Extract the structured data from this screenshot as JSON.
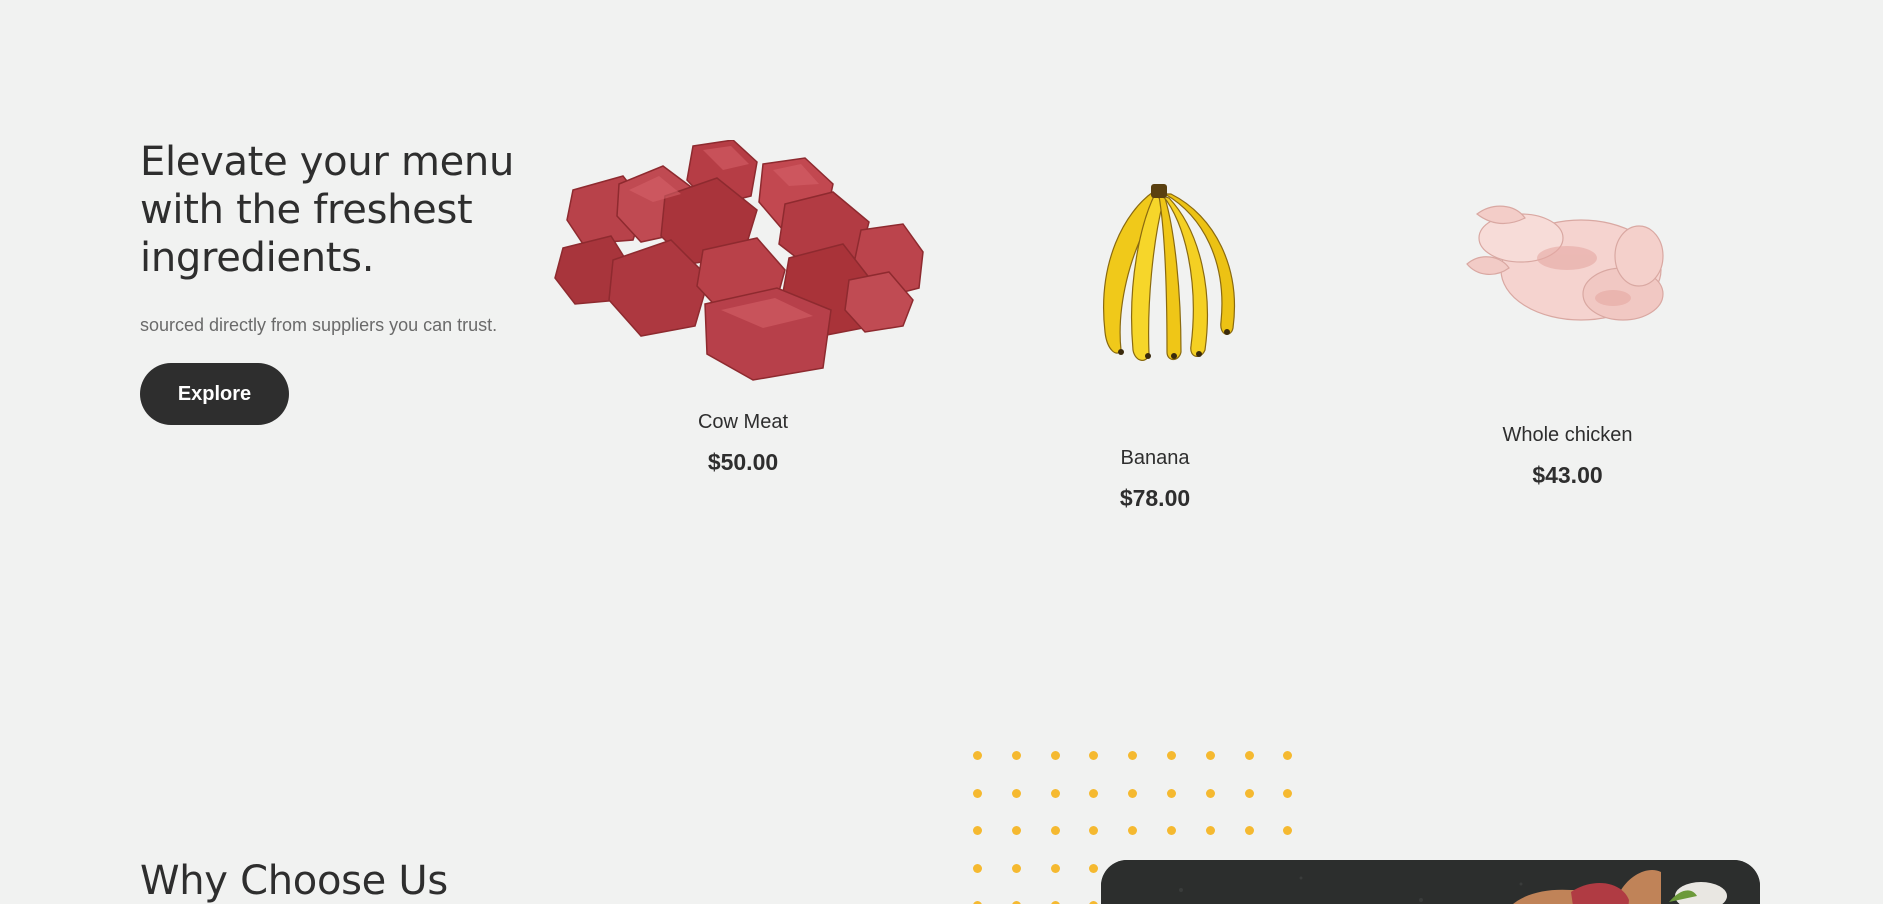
{
  "hero": {
    "title": "Elevate your menu with the freshest ingredients.",
    "subtitle": "sourced directly from suppliers you can trust.",
    "cta_label": "Explore"
  },
  "products": [
    {
      "name": "Cow Meat",
      "price": "$50.00"
    },
    {
      "name": "Banana",
      "price": "$78.00"
    },
    {
      "name": "Whole chicken",
      "price": "$43.00"
    }
  ],
  "why_section": {
    "title": "Why Choose Us"
  },
  "colors": {
    "background": "#f1f2f1",
    "text": "#2e2e2e",
    "button": "#2e2e2e",
    "dot_accent": "#f5b930",
    "meat": "#b53a40",
    "banana": "#f3d21b",
    "chicken": "#f4cfcb"
  }
}
